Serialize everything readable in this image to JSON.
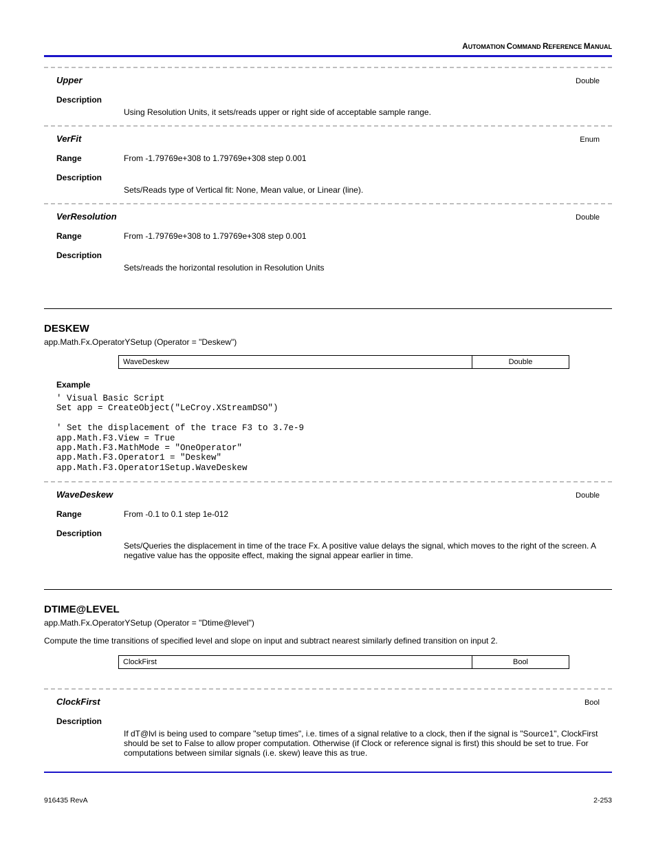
{
  "header": {
    "title_a": "A",
    "title_b": "UTOMATION ",
    "title_c": "C",
    "title_d": "OMMAND ",
    "title_e": "R",
    "title_f": "EFERENCE ",
    "title_g": "M",
    "title_h": "ANUAL"
  },
  "sec_upper": {
    "name": "Upper",
    "type": "Double",
    "desc_label": "Description",
    "desc": "Using Resolution Units, it sets/reads upper or right side of acceptable sample range."
  },
  "sec_verfit": {
    "name": "VerFit",
    "type": "Enum",
    "range_label": "Range",
    "range": "From -1.79769e+308 to 1.79769e+308 step 0.001",
    "desc_label": "Description",
    "desc": "Sets/Reads type of Vertical fit: None, Mean value, or Linear (line)."
  },
  "sec_verres": {
    "name": "VerResolution",
    "type": "Double",
    "range_label": "Range",
    "range": "From -1.79769e+308 to 1.79769e+308 step 0.001",
    "desc_label": "Description",
    "desc": "Sets/reads the horizontal resolution in Resolution Units"
  },
  "deskew": {
    "title": "DESKEW",
    "path": "app.Math.Fx.OperatorYSetup (Operator = \"Deskew\")",
    "table_left": "WaveDeskew",
    "table_right": "Double",
    "example_label": "Example"
  },
  "code": "' Visual Basic Script\nSet app = CreateObject(\"LeCroy.XStreamDSO\")\n\n' Set the displacement of the trace F3 to 3.7e-9\napp.Math.F3.View = True\napp.Math.F3.MathMode = \"OneOperator\"\napp.Math.F3.Operator1 = \"Deskew\"\napp.Math.F3.Operator1Setup.WaveDeskew",
  "sec_wavedeskew": {
    "name": "WaveDeskew",
    "type": "Double",
    "range_label": "Range",
    "range": "From -0.1 to 0.1 step 1e-012",
    "desc_label": "Description",
    "desc": "Sets/Queries the displacement in time of the trace Fx. A positive value delays the signal, which moves to the right of the screen. A negative value has the opposite effect, making the signal appear earlier in time."
  },
  "dtime": {
    "title": "DTIME@LEVEL",
    "path": "app.Math.Fx.OperatorYSetup (Operator = \"Dtime@level\")",
    "desc": "Compute the time transitions of specified level and slope on input and subtract nearest similarly defined transition on input 2.",
    "table_left": "ClockFirst",
    "table_right": "Bool"
  },
  "sec_clockfirst": {
    "name": "ClockFirst",
    "type": "Bool",
    "desc_label": "Description",
    "desc": "If dT@lvl is being used to compare \"setup times\", i.e. times of a signal relative to a clock, then if the signal is \"Source1\", ClockFirst should be set to False to allow proper computation. Otherwise (if Clock or reference signal is first) this should be set to true. For computations between similar signals (i.e. skew) leave this as true."
  },
  "footer": {
    "left": "916435 RevA",
    "right": "2-253"
  }
}
